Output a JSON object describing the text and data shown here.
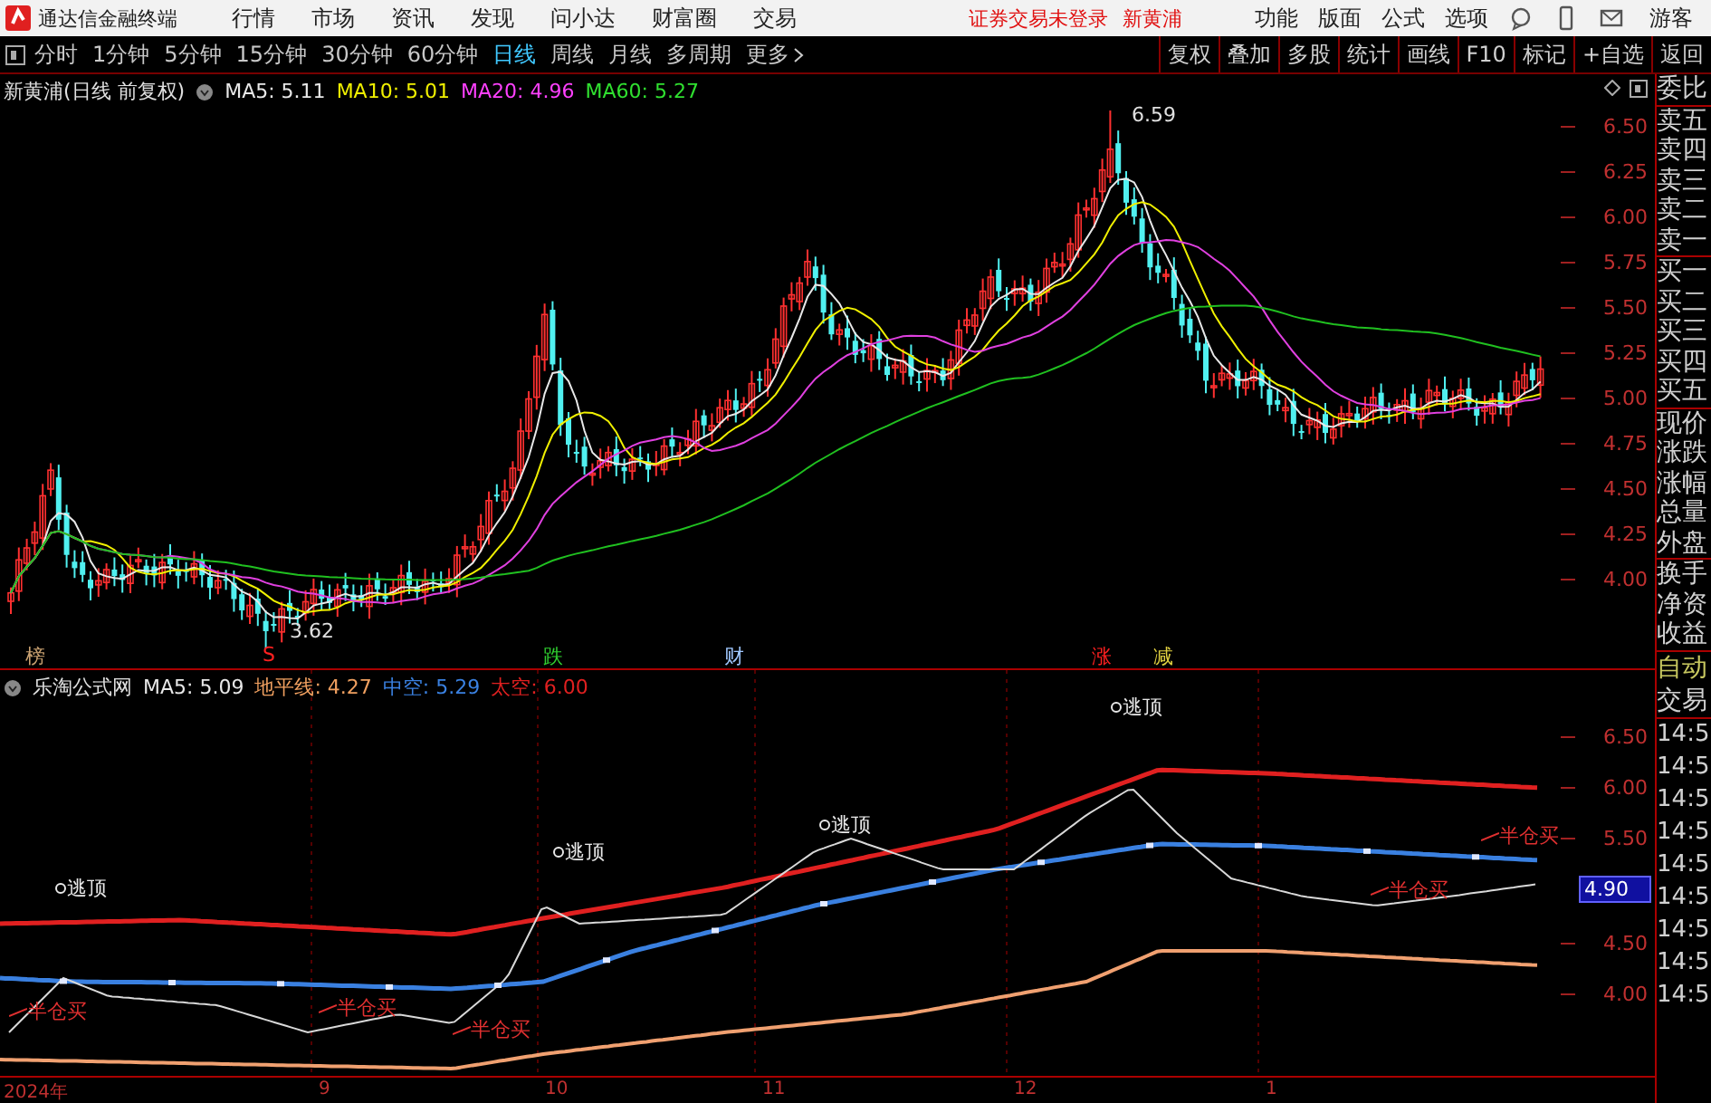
{
  "app_title": "通达信金融终端",
  "menu": [
    "行情",
    "市场",
    "资讯",
    "发现",
    "问小达",
    "财富圈",
    "交易"
  ],
  "login_status": "证券交易未登录",
  "login_stock": "新黄浦",
  "right_menu": [
    "功能",
    "版面",
    "公式",
    "选项"
  ],
  "user": "游客",
  "periods": [
    {
      "label": "分时",
      "selected": false
    },
    {
      "label": "1分钟",
      "selected": false
    },
    {
      "label": "5分钟",
      "selected": false
    },
    {
      "label": "15分钟",
      "selected": false
    },
    {
      "label": "30分钟",
      "selected": false
    },
    {
      "label": "60分钟",
      "selected": false
    },
    {
      "label": "日线",
      "selected": true
    },
    {
      "label": "周线",
      "selected": false
    },
    {
      "label": "月线",
      "selected": false
    },
    {
      "label": "多周期",
      "selected": false
    }
  ],
  "more": "更多",
  "tools": [
    "复权",
    "叠加",
    "多股",
    "统计",
    "画线",
    "F10",
    "标记",
    "+自选",
    "返回"
  ],
  "price_panel": {
    "title": "新黄浦(日线 前复权)",
    "legend": [
      {
        "label": "MA5: 5.11",
        "color": "#e8e8e8"
      },
      {
        "label": "MA10: 5.01",
        "color": "#f0f000"
      },
      {
        "label": "MA20: 4.96",
        "color": "#ff40ff"
      },
      {
        "label": "MA60: 5.27",
        "color": "#30e030"
      }
    ],
    "axis": [
      "6.50",
      "6.25",
      "6.00",
      "5.75",
      "5.50",
      "5.25",
      "5.00",
      "4.75",
      "4.50",
      "4.25",
      "4.00"
    ],
    "high_label": "6.59",
    "low_label": "3.62",
    "events": [
      {
        "text": "榜",
        "color": "#c8a070"
      },
      {
        "text": "S",
        "color": "#ff2020"
      },
      {
        "text": "跌",
        "color": "#30d030"
      },
      {
        "text": "财",
        "color": "#a0c8ff"
      },
      {
        "text": "涨",
        "color": "#ff2020"
      },
      {
        "text": "减",
        "color": "#e0d040"
      }
    ]
  },
  "indicator_panel": {
    "name": "乐淘公式网",
    "legend": [
      {
        "label": "MA5: 5.09",
        "color": "#e8e8e8"
      },
      {
        "label": "地平线: 4.27",
        "color": "#f0a060"
      },
      {
        "label": "中空: 5.29",
        "color": "#3a80e0"
      },
      {
        "label": "太空: 6.00",
        "color": "#e02020"
      }
    ],
    "axis": [
      "6.50",
      "6.00",
      "5.50",
      "4.50",
      "4.00"
    ],
    "cursor_price": "4.90",
    "signals": [
      {
        "kind": "top",
        "text": "逃顶"
      },
      {
        "kind": "top",
        "text": "逃顶"
      },
      {
        "kind": "top",
        "text": "逃顶"
      },
      {
        "kind": "top",
        "text": "逃顶"
      },
      {
        "kind": "buy",
        "text": "半仓买"
      },
      {
        "kind": "buy",
        "text": "半仓买"
      },
      {
        "kind": "buy",
        "text": "半仓买"
      },
      {
        "kind": "buy",
        "text": "半仓买"
      },
      {
        "kind": "buy",
        "text": "半仓买"
      }
    ]
  },
  "date_axis": [
    "2024年",
    "9",
    "10",
    "11",
    "12",
    "1"
  ],
  "quote_groups": [
    [
      "委比"
    ],
    [
      "卖五",
      "卖四",
      "卖三",
      "卖二",
      "卖一"
    ],
    [
      "买一",
      "买二",
      "买三",
      "买四",
      "买五"
    ],
    [
      "现价",
      "涨跌",
      "涨幅",
      "总量",
      "外盘"
    ],
    [
      "换手",
      "净资",
      "收益"
    ]
  ],
  "trade": {
    "title": "自动",
    "header": "交易",
    "times": [
      "14:5",
      "14:5",
      "14:5",
      "14:5",
      "14:5",
      "14:5",
      "14:5",
      "14:5",
      "14:5"
    ]
  }
}
